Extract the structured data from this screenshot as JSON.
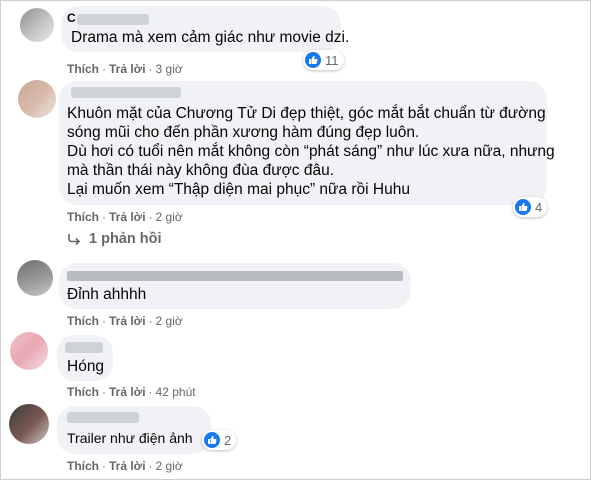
{
  "actions": {
    "like": "Thích",
    "reply": "Trả lời",
    "separator": "·"
  },
  "comments": [
    {
      "name": "C",
      "text": "Drama mà xem cảm giác như movie dzi.",
      "time": "3 giờ",
      "reactions": "11",
      "reaction_icon": "like-icon",
      "accent": "#1877f2"
    },
    {
      "name": "",
      "text_lines": [
        "Khuôn mặt của Chương Tử Di đẹp thiệt, góc mắt bắt chuẩn từ đường",
        "sóng mũi cho đến phần xương hàm đúng đẹp luôn.",
        "Dù hơi có tuổi nên mắt không còn “phát sáng” như lúc xưa nữa, nhưng",
        "mà thần thái này không đùa được đâu.",
        "Lại muốn xem “Thập diện mai phục” nữa rồi Huhu"
      ],
      "time": "2 giờ",
      "reactions": "4",
      "replies_label": "1 phản hồi"
    },
    {
      "name": "",
      "text": "Đỉnh ahhhh",
      "time": "2 giờ"
    },
    {
      "name": "",
      "text": "Hóng",
      "time": "42 phút"
    },
    {
      "name": "",
      "text": "Trailer như điện ảnh",
      "time": "2 giờ",
      "reactions": "2"
    }
  ]
}
